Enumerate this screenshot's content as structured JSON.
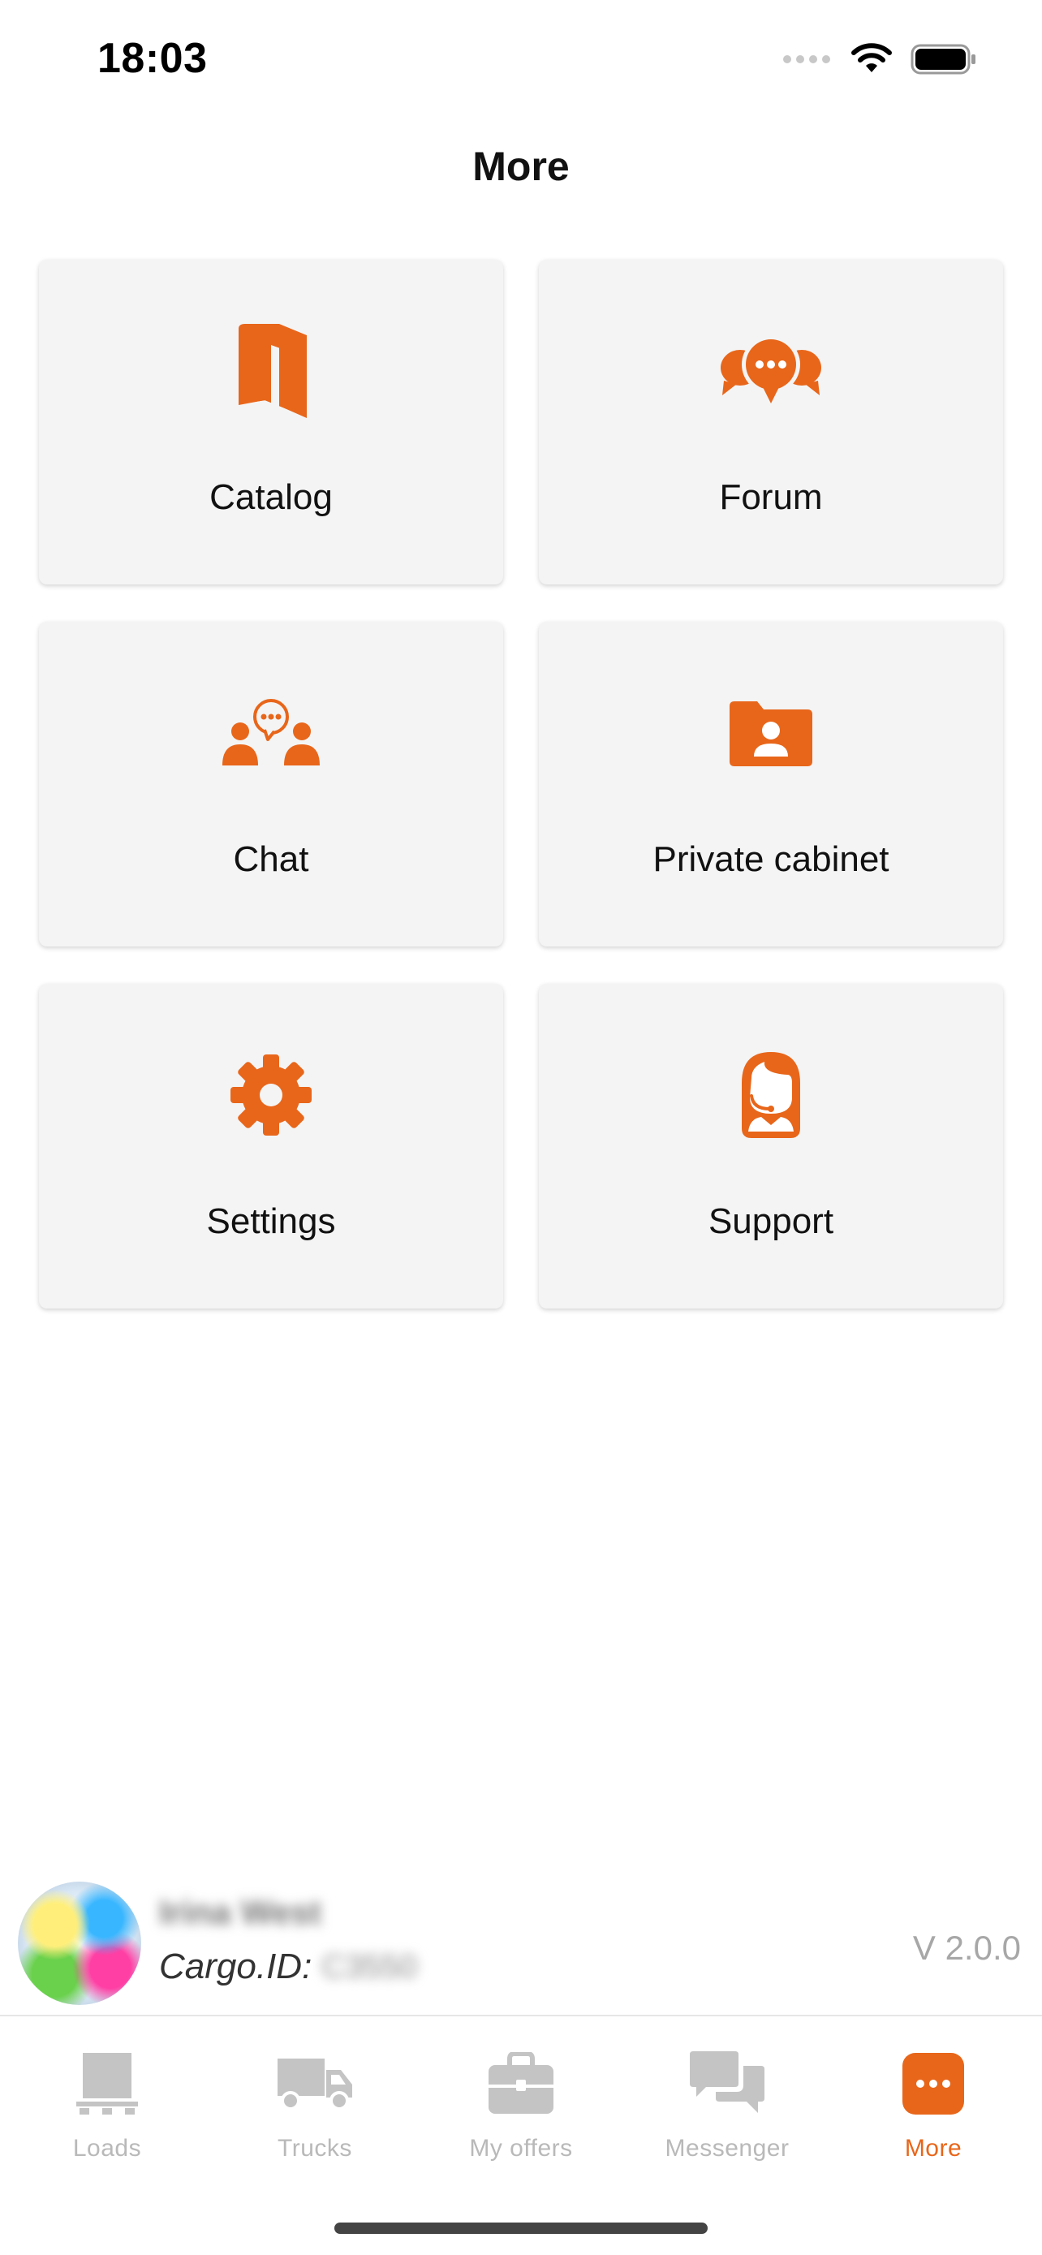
{
  "status": {
    "time": "18:03"
  },
  "header": {
    "title": "More"
  },
  "menu": {
    "items": [
      {
        "label": "Catalog",
        "icon": "book-icon"
      },
      {
        "label": "Forum",
        "icon": "forum-icon"
      },
      {
        "label": "Chat",
        "icon": "group-chat-icon"
      },
      {
        "label": "Private cabinet",
        "icon": "user-folder-icon"
      },
      {
        "label": "Settings",
        "icon": "gear-icon"
      },
      {
        "label": "Support",
        "icon": "support-agent-icon"
      }
    ]
  },
  "profile": {
    "name": "Irina West",
    "cargo_label": "Cargo.ID:",
    "cargo_id": "C3550",
    "version": "V 2.0.0"
  },
  "tabs": [
    {
      "label": "Loads",
      "icon": "pallet-icon"
    },
    {
      "label": "Trucks",
      "icon": "truck-icon"
    },
    {
      "label": "My offers",
      "icon": "briefcase-icon"
    },
    {
      "label": "Messenger",
      "icon": "chat-bubbles-icon"
    },
    {
      "label": "More",
      "icon": "more-dots-icon",
      "active": true
    }
  ],
  "colors": {
    "accent": "#e8661a",
    "tile_bg": "#f4f4f4",
    "tab_inactive": "#b9b9b9"
  }
}
